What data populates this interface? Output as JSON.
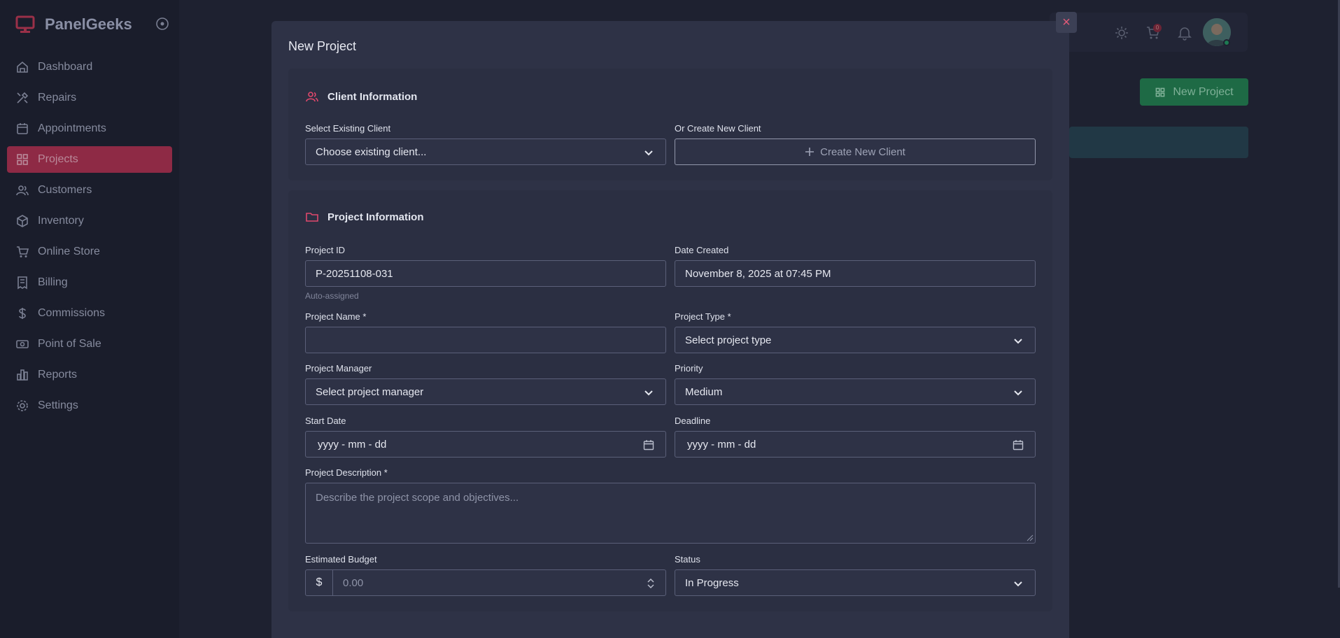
{
  "brand": {
    "name": "PanelGeeks"
  },
  "sidebar": {
    "items": [
      {
        "label": "Dashboard",
        "icon": "home-icon"
      },
      {
        "label": "Repairs",
        "icon": "tools-icon"
      },
      {
        "label": "Appointments",
        "icon": "calendar-icon"
      },
      {
        "label": "Projects",
        "icon": "grid-icon",
        "active": true
      },
      {
        "label": "Customers",
        "icon": "users-icon"
      },
      {
        "label": "Inventory",
        "icon": "box-icon"
      },
      {
        "label": "Online Store",
        "icon": "cart-icon"
      },
      {
        "label": "Billing",
        "icon": "receipt-icon"
      },
      {
        "label": "Commissions",
        "icon": "dollar-icon"
      },
      {
        "label": "Point of Sale",
        "icon": "cash-icon"
      },
      {
        "label": "Reports",
        "icon": "bar-chart-icon"
      },
      {
        "label": "Settings",
        "icon": "gear-icon"
      }
    ]
  },
  "header": {
    "cart_badge": "0",
    "new_project_label": "New Project"
  },
  "modal": {
    "title": "New Project",
    "close_label": "×",
    "client": {
      "heading": "Client Information",
      "existing_label": "Select Existing Client",
      "existing_value": "Choose existing client...",
      "create_label": "Or Create New Client",
      "create_button": "Create New Client"
    },
    "project": {
      "heading": "Project Information",
      "id_label": "Project ID",
      "id_value": "P-20251108-031",
      "id_hint": "Auto-assigned",
      "date_label": "Date Created",
      "date_value": "November 8, 2025 at 07:45 PM",
      "name_label": "Project Name *",
      "name_value": "",
      "type_label": "Project Type *",
      "type_value": "Select project type",
      "manager_label": "Project Manager",
      "manager_value": "Select project manager",
      "priority_label": "Priority",
      "priority_value": "Medium",
      "start_label": "Start Date",
      "start_placeholder": "yyyy - mm - dd",
      "deadline_label": "Deadline",
      "deadline_placeholder": "yyyy - mm - dd",
      "desc_label": "Project Description *",
      "desc_placeholder": "Describe the project scope and objectives...",
      "budget_label": "Estimated Budget",
      "budget_prefix": "$",
      "budget_placeholder": "0.00",
      "status_label": "Status",
      "status_value": "In Progress"
    }
  },
  "colors": {
    "accent": "#e0486c",
    "active_nav": "#8e2a45",
    "success": "#1e6a45"
  }
}
